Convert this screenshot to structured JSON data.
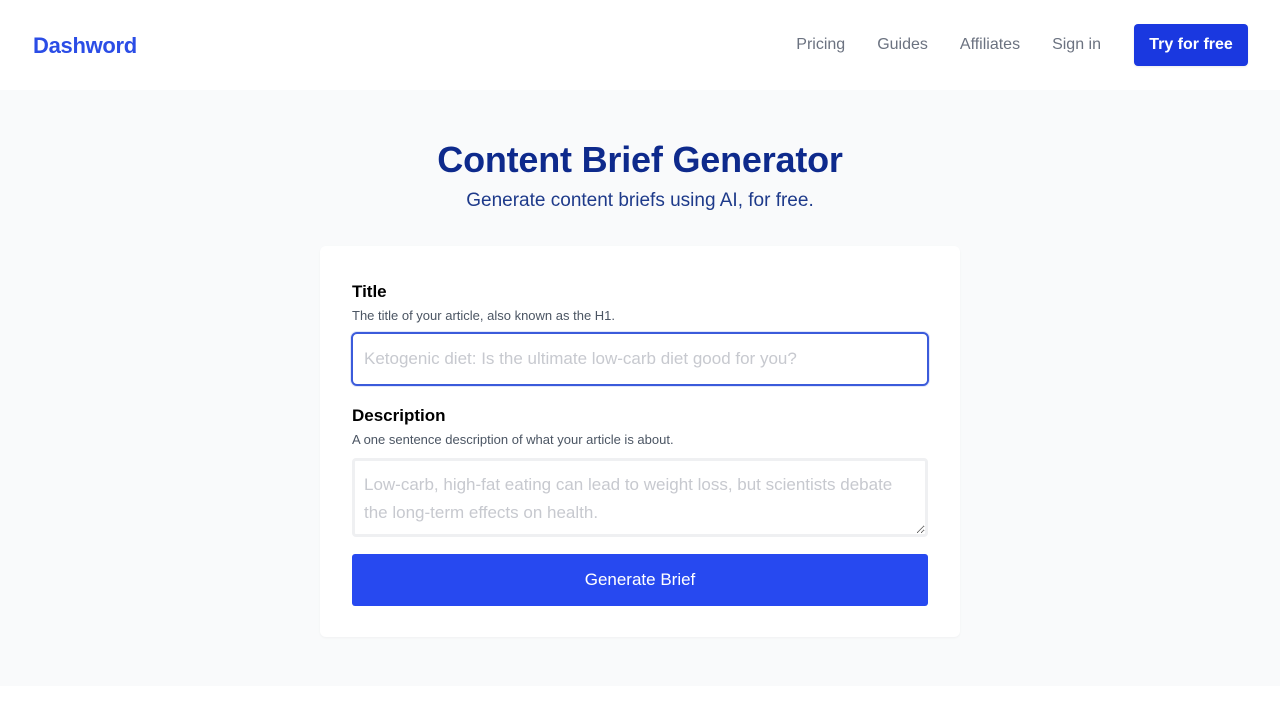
{
  "header": {
    "logo": "Dashword",
    "nav": [
      "Pricing",
      "Guides",
      "Affiliates",
      "Sign in"
    ],
    "cta_label": "Try for free"
  },
  "hero": {
    "title": "Content Brief Generator",
    "subtitle": "Generate content briefs using AI, for free."
  },
  "form": {
    "title_field": {
      "label": "Title",
      "help": "The title of your article, also known as the H1.",
      "value": "",
      "placeholder": "Ketogenic diet: Is the ultimate low-carb diet good for you?"
    },
    "description_field": {
      "label": "Description",
      "help": "A one sentence description of what your article is about.",
      "value": "",
      "placeholder": "Low-carb, high-fat eating can lead to weight loss, but scientists debate the long-term effects on health."
    },
    "submit_label": "Generate Brief"
  },
  "colors": {
    "brand": "#2b4de6",
    "cta": "#1a38e0",
    "heading": "#0e2a8c",
    "submit": "#2749f0"
  }
}
